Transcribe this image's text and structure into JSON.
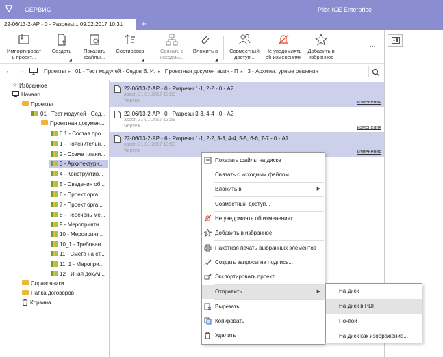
{
  "window": {
    "menu": "СЕРВИС",
    "app_name": "Pilot-ICE Enterprise"
  },
  "tabs": [
    {
      "label": "22-06/13-2-АР - 0 - Разрезы... 09.02.2017 10:31"
    }
  ],
  "toolbar": {
    "import": [
      "Импортироват",
      "ь проект..."
    ],
    "create": [
      "Создать",
      ""
    ],
    "show_files": [
      "Показать",
      "файлы..."
    ],
    "sort": [
      "Сортировка",
      ""
    ],
    "link_source": [
      "Связать с",
      "исходны..."
    ],
    "attach": [
      "Вложить в",
      ""
    ],
    "share": [
      "Совместный",
      "доступ..."
    ],
    "no_notify": [
      "Не уведомлять",
      "об изменениях"
    ],
    "favorite": [
      "Добавить в",
      "избранное"
    ],
    "more": "..."
  },
  "breadcrumb": [
    "Проекты",
    "01 - Тест модулей - Седов В. И.",
    "Проектная документация - П",
    "3 - Архитектурные решения"
  ],
  "tree": [
    {
      "label": "Избранное",
      "icon": "star-icon"
    },
    {
      "label": "Начало",
      "icon": "monitor-icon"
    },
    {
      "label": "Проекты",
      "icon": "folder-icon"
    },
    {
      "label": "01 - Тест модулей - Сед...",
      "icon": "project-icon"
    },
    {
      "label": "Проектная докумен...",
      "icon": "folder-icon"
    },
    {
      "label": "0.1 - Состав про...",
      "icon": "docs-icon"
    },
    {
      "label": "1 - Пояснительн...",
      "icon": "docs-icon"
    },
    {
      "label": "2 - Схема плани...",
      "icon": "docs-icon"
    },
    {
      "label": "3 - Архитектурн...",
      "icon": "docs-icon",
      "selected": true
    },
    {
      "label": "4 - Конструктив...",
      "icon": "docs-icon"
    },
    {
      "label": "5 - Сведения об...",
      "icon": "docs-icon"
    },
    {
      "label": "6 - Проект орга...",
      "icon": "docs-icon"
    },
    {
      "label": "7 - Проект орга...",
      "icon": "docs-icon"
    },
    {
      "label": "8 - Перечень ме...",
      "icon": "docs-icon"
    },
    {
      "label": "9 - Мероприяти...",
      "icon": "docs-icon"
    },
    {
      "label": "10 - Мероприят...",
      "icon": "docs-icon"
    },
    {
      "label": "10_1 - Требован...",
      "icon": "docs-icon"
    },
    {
      "label": "11 - Смета на ст...",
      "icon": "docs-icon"
    },
    {
      "label": "11_1 - Меропри...",
      "icon": "docs-icon"
    },
    {
      "label": "12 - Иная докум...",
      "icon": "docs-icon"
    },
    {
      "label": "Справочники",
      "icon": "folder-icon"
    },
    {
      "label": "Папка договоров",
      "icon": "folder-icon"
    },
    {
      "label": "Корзина",
      "icon": "trash-icon"
    }
  ],
  "documents": [
    {
      "title": "22-06/13-2-АР - 0 - Разрезы 1-1, 2-2 - 0 - А2",
      "meta": "ascon 31.01.2017 13:59",
      "kind": "Чертеж",
      "link": "изменения",
      "selected": true
    },
    {
      "title": "22-06/13-2-АР - 0 - Разрезы 3-3, 4-4 - 0 - А2",
      "meta": "ascon 31.01.2017 13:59",
      "kind": "Чертеж",
      "link": "изменения",
      "selected": false
    },
    {
      "title": "22-06/13-2-АР - 6 - Разрезы 1-1, 2-2, 3-3, 4-4, 5-5, 6-6, 7-7 - 0 - А1",
      "meta": "ascon 31.01.2017 13:59",
      "kind": "Чертеж",
      "link": "изменения",
      "selected": true
    }
  ],
  "context_menu": [
    "Показать файлы на диске",
    "Связать с исходным файлом...",
    "Вложить в",
    "Совместный доступ...",
    "Не уведомлять об изменениях",
    "Добавить в избранное",
    "Пакетная печать выбранных элементов",
    "Создать запросы на подпись...",
    "Экспортировать проект...",
    "Отправить",
    "Вырезать",
    "Копировать",
    "Удалить"
  ],
  "submenu": [
    "На диск",
    "На диск в PDF",
    "Почтой",
    "На диск как изображение..."
  ],
  "colors": {
    "accent": "#8a8ed1",
    "selection": "#ccd0ea",
    "folder": "#f0b43a",
    "danger": "#d9412e"
  }
}
